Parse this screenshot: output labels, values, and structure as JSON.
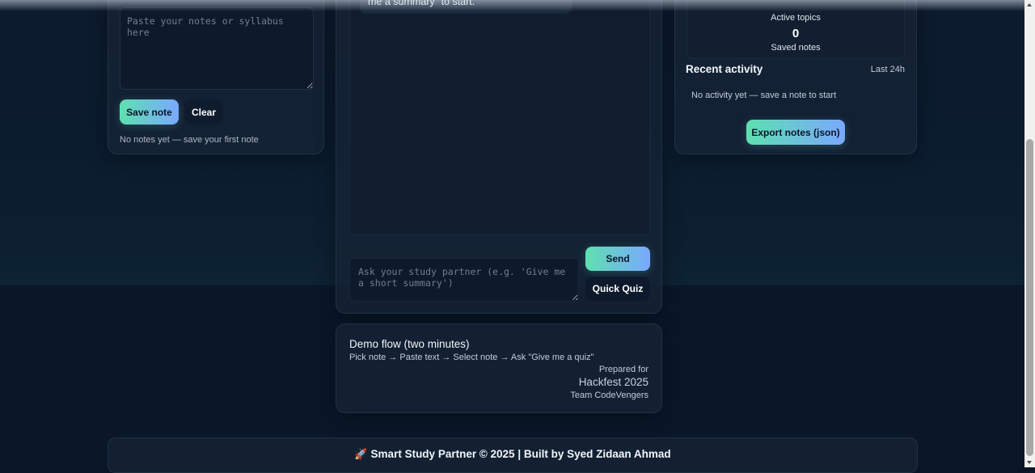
{
  "notes": {
    "placeholder": "Paste your notes or syllabus here",
    "save_label": "Save note",
    "clear_label": "Clear",
    "empty_text": "No notes yet — save your first note"
  },
  "chat": {
    "bubble_text": "me a summary\" to start.",
    "input_placeholder": "Ask your study partner (e.g. 'Give me a short summary')",
    "send_label": "Send",
    "quiz_label": "Quick Quiz"
  },
  "demo": {
    "title": "Demo flow (two minutes)",
    "steps": "Pick note → Paste text → Select note → Ask \"Give me a quiz\"",
    "prepared_for_label": "Prepared for",
    "event": "Hackfest 2025",
    "team": "Team CodeVengers"
  },
  "stats": {
    "active_topics_label": "Active topics",
    "saved_notes_value": "0",
    "saved_notes_label": "Saved notes"
  },
  "activity": {
    "title": "Recent activity",
    "range": "Last 24h",
    "empty_text": "No activity yet — save a note to start",
    "export_label": "Export notes (json)"
  },
  "footer": {
    "icon": "rocket-icon",
    "text": "Smart Study Partner © 2025 | Built by Syed Zidaan Ahmad"
  },
  "colors": {
    "accent_start": "#5ee0b0",
    "accent_end": "#7aa8ff",
    "background": "#0a1628"
  }
}
